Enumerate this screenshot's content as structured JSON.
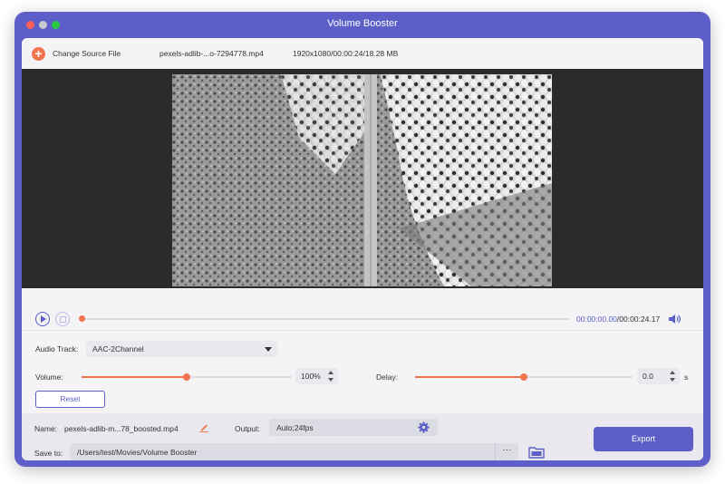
{
  "window": {
    "title": "Volume Booster"
  },
  "topbar": {
    "change_source_label": "Change Source File",
    "file_name": "pexels-adlib-...o-7294778.mp4",
    "file_info": "1920x1080/00:00:24/18.28 MB"
  },
  "player": {
    "current_time": "00:00:00.00",
    "total_time": "/00:00:24.17",
    "progress_fraction": 0.0
  },
  "settings": {
    "audio_track_label": "Audio Track:",
    "audio_track_value": "AAC-2Channel",
    "volume_label": "Volume:",
    "volume_value": "100%",
    "volume_fraction": 0.5,
    "delay_label": "Delay:",
    "delay_value": "0.0",
    "delay_unit": "s",
    "delay_fraction": 0.5,
    "reset_label": "Reset"
  },
  "output": {
    "name_label": "Name:",
    "name_value": "pexels-adlib-m...78_boosted.mp4",
    "output_label": "Output:",
    "output_value": "Auto;24fps",
    "save_to_label": "Save to:",
    "save_to_value": "/Users/test/Movies/Volume Booster",
    "more_label": "···",
    "export_label": "Export"
  },
  "colors": {
    "accent": "#5b5fc7",
    "slider": "#f2744e"
  }
}
